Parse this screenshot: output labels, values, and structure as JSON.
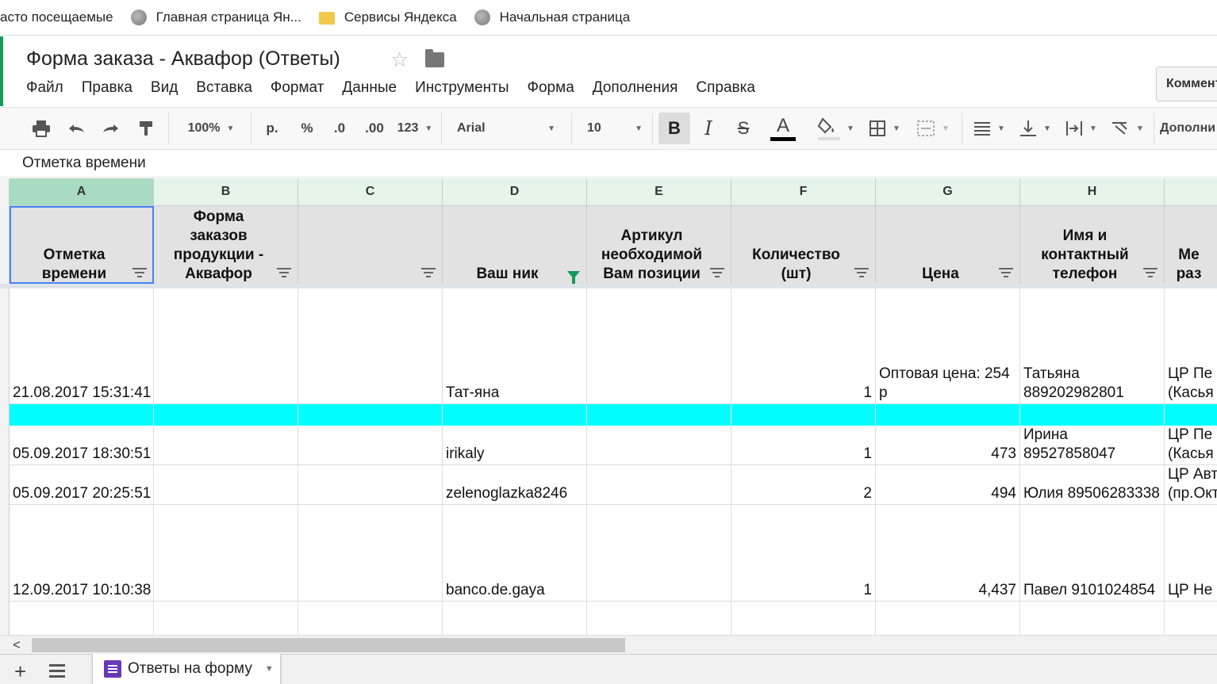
{
  "bookmarks": [
    {
      "label": "асто посещаемые",
      "icon": "none"
    },
    {
      "label": "Главная страница Ян...",
      "icon": "globe-icon"
    },
    {
      "label": "Сервисы Яндекса",
      "icon": "folder-icon"
    },
    {
      "label": "Начальная страница",
      "icon": "globe-icon"
    }
  ],
  "doc": {
    "title": "Форма заказа - Аквафор (Ответы)",
    "star_glyph": "☆",
    "comments_label": "Коммент"
  },
  "menu": [
    "Файл",
    "Правка",
    "Вид",
    "Вставка",
    "Формат",
    "Данные",
    "Инструменты",
    "Форма",
    "Дополнения",
    "Справка"
  ],
  "toolbar": {
    "zoom": "100%",
    "currency": "р.",
    "percent": "%",
    "dec_less": ".0",
    "dec_more": ".00",
    "more_formats": "123",
    "font": "Arial",
    "font_size": "10",
    "bold": "B",
    "italic": "I",
    "strike": "S",
    "text_color": "A",
    "more": "Дополни"
  },
  "formula_bar": {
    "value": "Отметка времени"
  },
  "columns": [
    "A",
    "B",
    "C",
    "D",
    "E",
    "F",
    "G",
    "H",
    ""
  ],
  "header_row": [
    {
      "lines": [
        "Отметка",
        "времени"
      ],
      "filter": "normal"
    },
    {
      "lines": [
        "Форма",
        "заказов",
        "продукции -",
        "Аквафор"
      ],
      "filter": "normal"
    },
    {
      "lines": [
        ""
      ],
      "filter": "normal"
    },
    {
      "lines": [
        "Ваш ник"
      ],
      "filter": "active"
    },
    {
      "lines": [
        "Артикул",
        "необходимой",
        "Вам позиции"
      ],
      "filter": "normal"
    },
    {
      "lines": [
        "Количество",
        "(шт)"
      ],
      "filter": "normal"
    },
    {
      "lines": [
        "Цена"
      ],
      "filter": "normal"
    },
    {
      "lines": [
        "Имя и",
        "контактный",
        "телефон"
      ],
      "filter": "normal"
    },
    {
      "lines": [
        "Ме",
        "раз"
      ],
      "filter": "none"
    }
  ],
  "rows": [
    {
      "cells": [
        [
          "21.08.2017 15:31:41"
        ],
        [
          ""
        ],
        [
          ""
        ],
        [
          "Тат-яна"
        ],
        [
          ""
        ],
        [
          "1"
        ],
        [
          "Оптовая цена: 254",
          "р"
        ],
        [
          "Татьяна",
          "889202982801"
        ],
        [
          "ЦР Пе",
          "(Касья"
        ]
      ],
      "highlight": false
    },
    {
      "cells": [
        [
          ""
        ],
        [
          ""
        ],
        [
          ""
        ],
        [
          ""
        ],
        [
          ""
        ],
        [
          ""
        ],
        [
          ""
        ],
        [
          ""
        ],
        [
          ""
        ]
      ],
      "highlight": true
    },
    {
      "cells": [
        [
          "05.09.2017 18:30:51"
        ],
        [
          ""
        ],
        [
          ""
        ],
        [
          "irikaly"
        ],
        [
          ""
        ],
        [
          "1"
        ],
        [
          "473"
        ],
        [
          "Ирина",
          "89527858047"
        ],
        [
          "ЦР Пе",
          "(Касья"
        ]
      ],
      "highlight": false
    },
    {
      "cells": [
        [
          "05.09.2017 20:25:51"
        ],
        [
          ""
        ],
        [
          ""
        ],
        [
          "zelenoglazka8246"
        ],
        [
          ""
        ],
        [
          "2"
        ],
        [
          "494"
        ],
        [
          "Юлия 89506283338"
        ],
        [
          "ЦР Авт",
          "(пр.Окт"
        ]
      ],
      "highlight": false
    },
    {
      "cells": [
        [
          "12.09.2017 10:10:38"
        ],
        [
          ""
        ],
        [
          ""
        ],
        [
          "banco.de.gaya"
        ],
        [
          ""
        ],
        [
          "1"
        ],
        [
          "4,437"
        ],
        [
          "Павел 9101024854"
        ],
        [
          "ЦР Не"
        ]
      ],
      "highlight": false
    },
    {
      "cells": [
        [
          ""
        ],
        [
          ""
        ],
        [
          ""
        ],
        [
          ""
        ],
        [
          ""
        ],
        [
          ""
        ],
        [
          ""
        ],
        [
          ""
        ],
        [
          ""
        ]
      ],
      "highlight": false
    }
  ],
  "sheet_tab": {
    "label": "Ответы на форму"
  },
  "colors": {
    "accent": "#0f9d58",
    "highlight_row": "#00ffff",
    "selection": "#4285f4"
  }
}
